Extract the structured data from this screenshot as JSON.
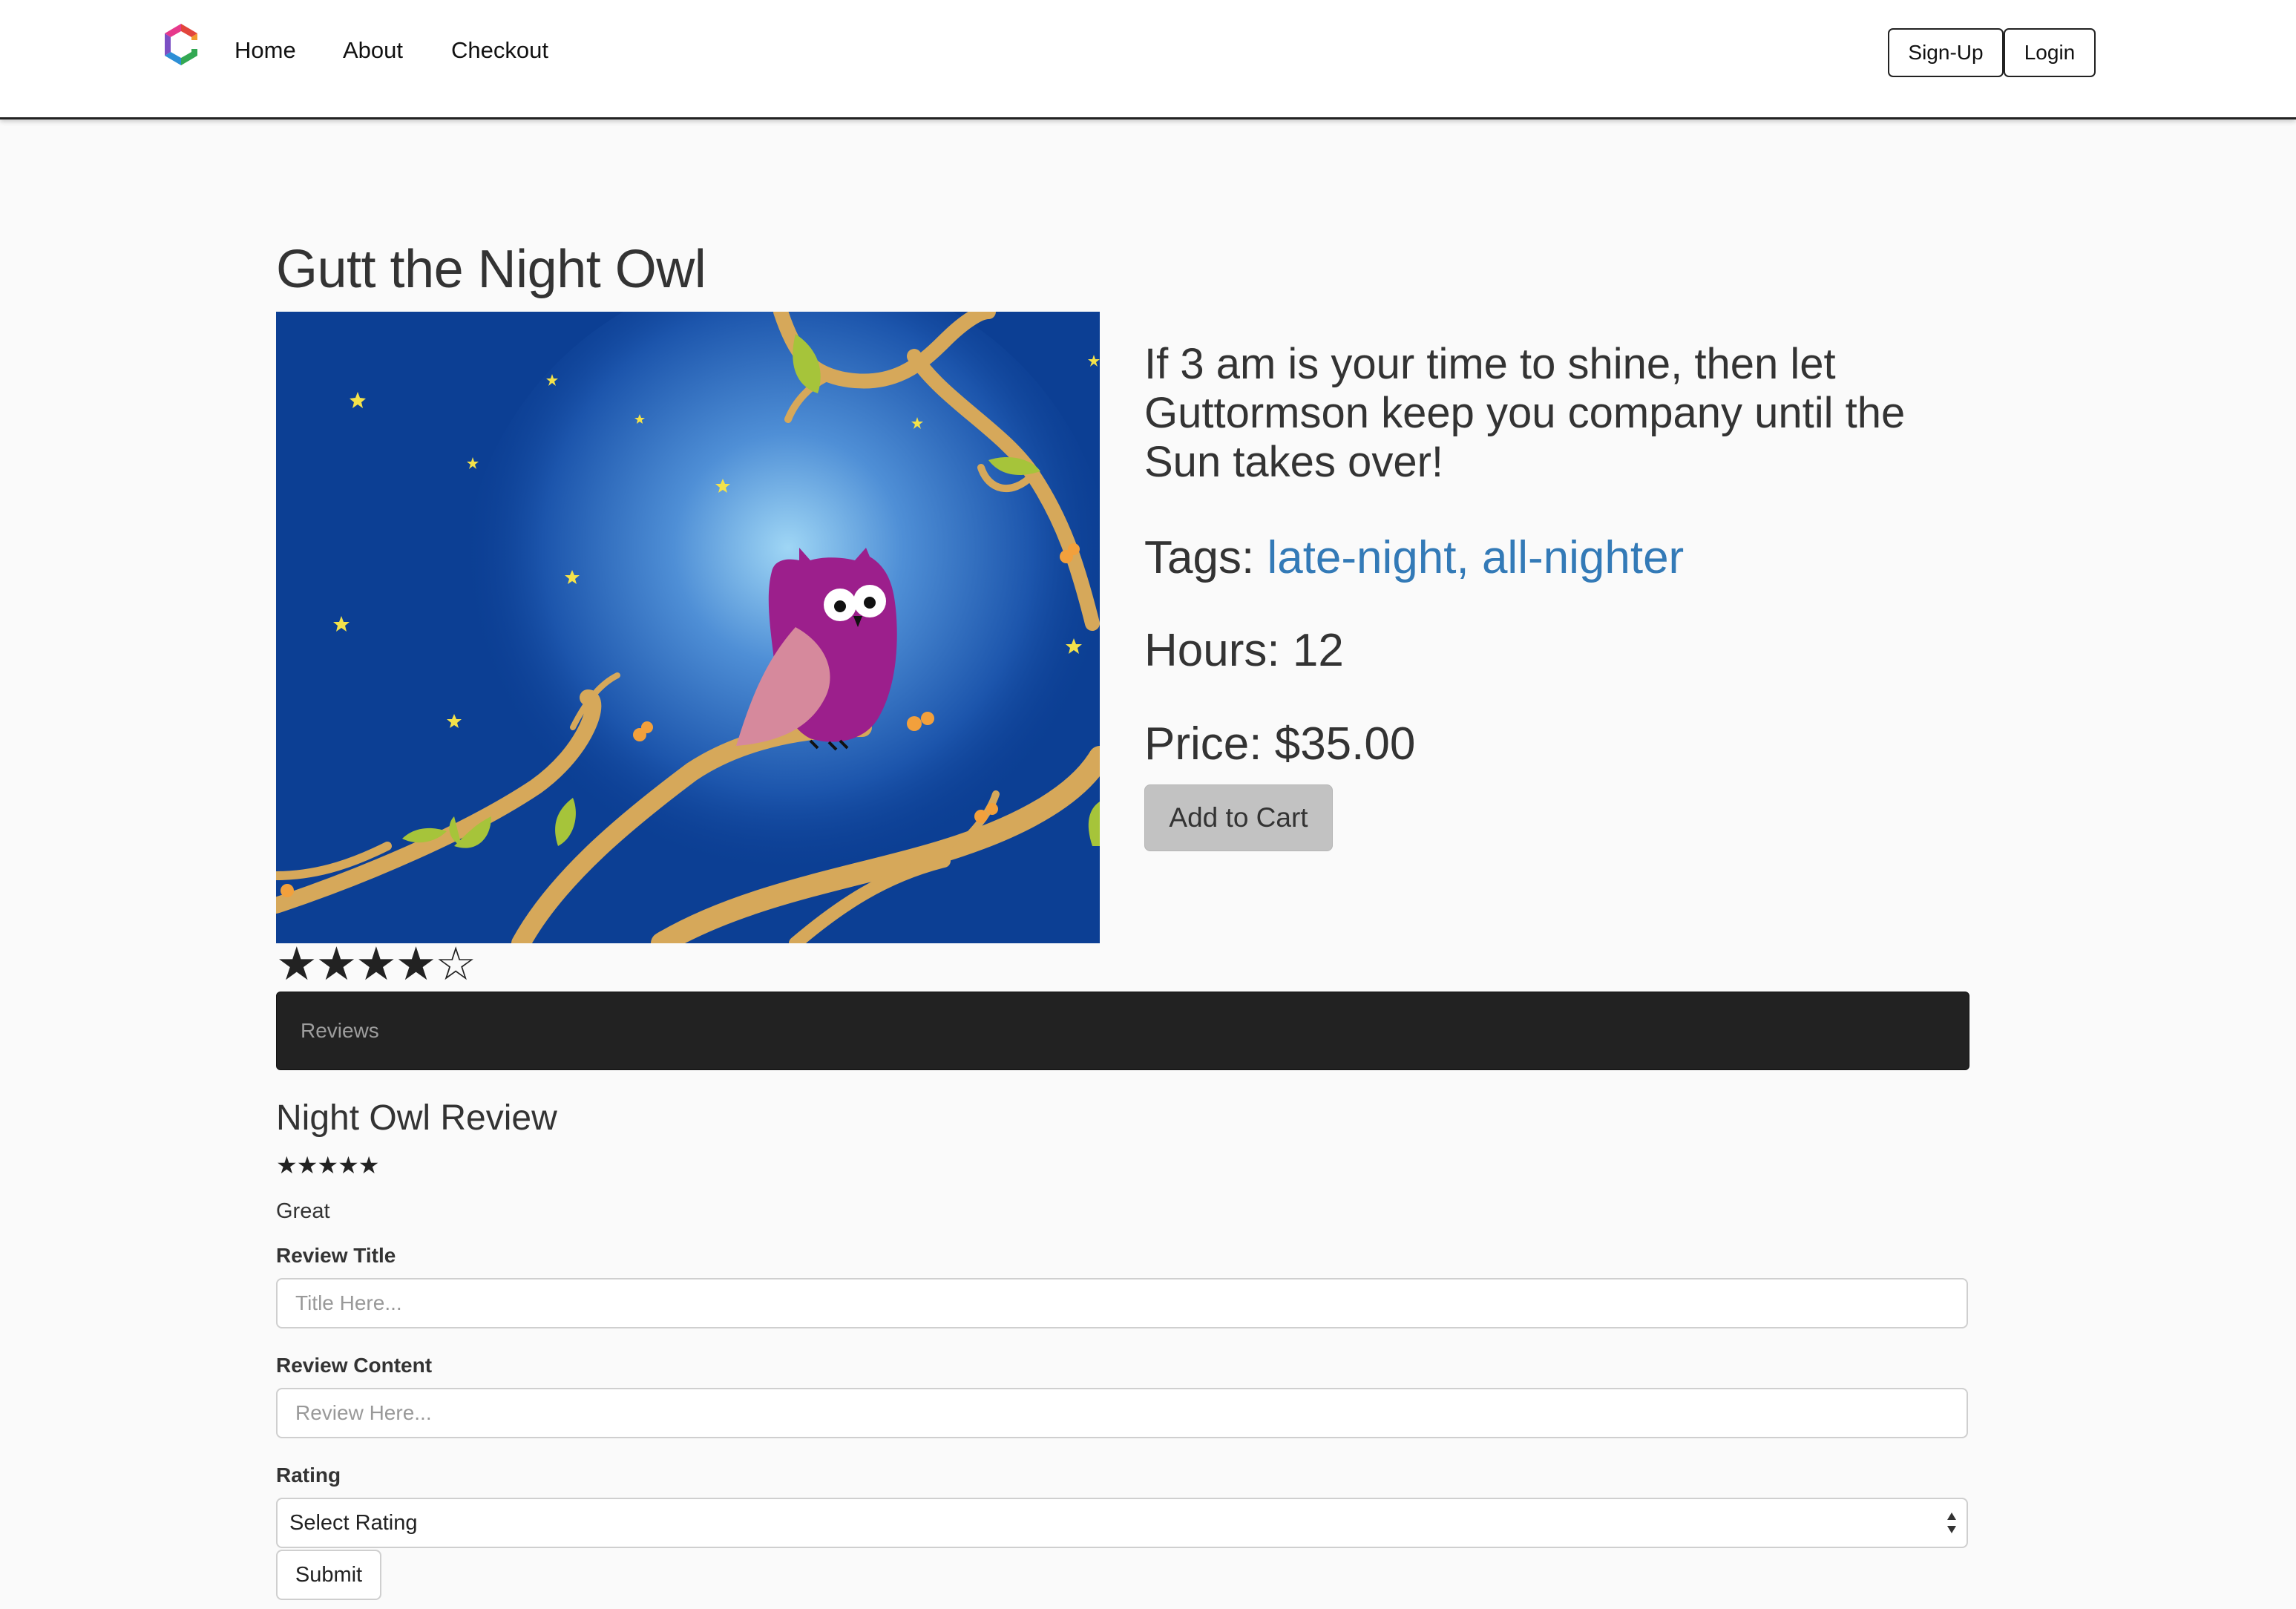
{
  "nav": {
    "links": [
      "Home",
      "About",
      "Checkout"
    ],
    "signup_label": "Sign-Up",
    "login_label": "Login"
  },
  "product": {
    "title": "Gutt the Night Owl",
    "description": "If 3 am is your time to shine, then let Guttormson keep you company until the Sun takes over!",
    "tags_label": "Tags:",
    "tags": "late-night, all-nighter",
    "hours_label": "Hours:",
    "hours": "12",
    "price_label": "Price:",
    "price": "$35.00",
    "add_to_cart_label": "Add to Cart",
    "rating_stars": "★★★★☆",
    "rating": 4,
    "rating_max": 5
  },
  "reviews": {
    "tab_label": "Reviews",
    "items": [
      {
        "title": "Night Owl Review",
        "stars": "★★★★★",
        "rating": 5,
        "body": "Great"
      }
    ]
  },
  "review_form": {
    "title_label": "Review Title",
    "title_placeholder": "Title Here...",
    "content_label": "Review Content",
    "content_placeholder": "Review Here...",
    "rating_label": "Rating",
    "rating_selected": "Select Rating",
    "submit_label": "Submit"
  },
  "colors": {
    "link": "#337ab7",
    "navbar_dark": "#222222",
    "button_gray": "#c2c2c2",
    "sky_blue": "#0c3f94",
    "owl_purple": "#9c1f8c"
  }
}
